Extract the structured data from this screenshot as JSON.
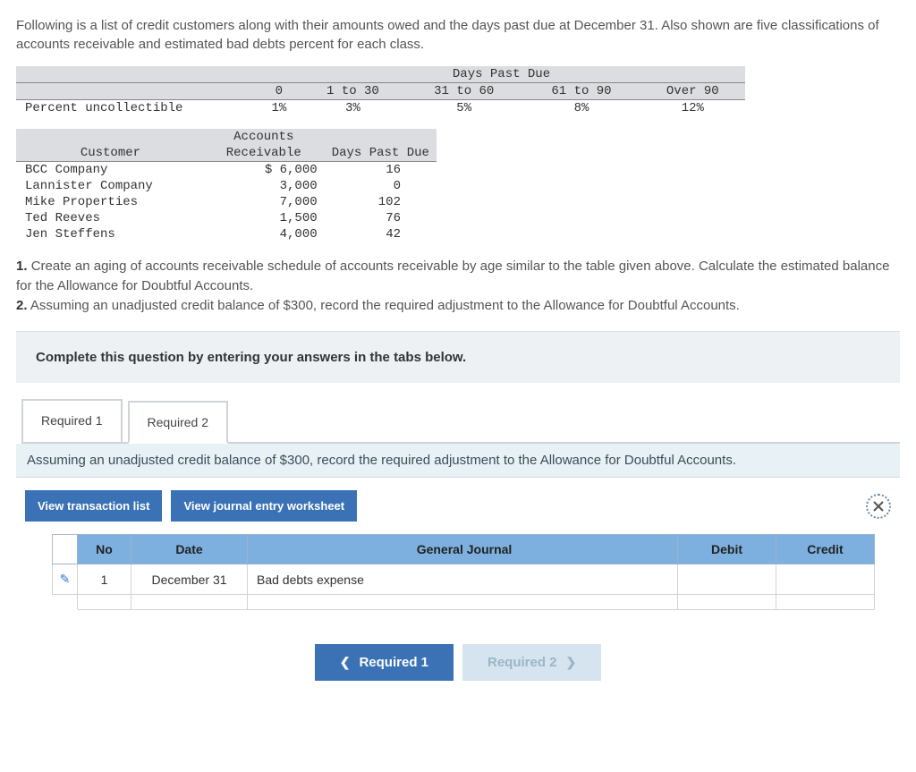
{
  "intro": "Following is a list of credit customers along with their amounts owed and the days past due at December 31. Also shown are five classifications of accounts receivable and estimated bad debts percent for each class.",
  "aging": {
    "top_header": "Days Past Due",
    "cols": [
      "0",
      "1 to 30",
      "31 to 60",
      "61 to 90",
      "Over 90"
    ],
    "row_label": "Percent uncollectible",
    "percents": [
      "1%",
      "3%",
      "5%",
      "8%",
      "12%"
    ]
  },
  "customers": {
    "headers": [
      "Customer",
      "Accounts Receivable",
      "Days Past Due"
    ],
    "rows": [
      {
        "name": "BCC Company",
        "ar": "$ 6,000",
        "dpd": "16"
      },
      {
        "name": "Lannister Company",
        "ar": "3,000",
        "dpd": "0"
      },
      {
        "name": "Mike Properties",
        "ar": "7,000",
        "dpd": "102"
      },
      {
        "name": "Ted Reeves",
        "ar": "1,500",
        "dpd": "76"
      },
      {
        "name": "Jen Steffens",
        "ar": "4,000",
        "dpd": "42"
      }
    ]
  },
  "questions": {
    "q1": "Create an aging of accounts receivable schedule of accounts receivable by age similar to the table given above. Calculate the estimated balance for the Allowance for Doubtful Accounts.",
    "q2": "Assuming an unadjusted credit balance of $300, record the required adjustment to the Allowance for Doubtful Accounts."
  },
  "complete": "Complete this question by entering your answers in the tabs below.",
  "tabs": {
    "t1": "Required 1",
    "t2": "Required 2"
  },
  "prompt": "Assuming an unadjusted credit balance of $300, record the required adjustment to the Allowance for Doubtful Accounts.",
  "buttons": {
    "vtl": "View transaction list",
    "vjew": "View journal entry worksheet"
  },
  "journal": {
    "headers": {
      "no": "No",
      "date": "Date",
      "gj": "General Journal",
      "debit": "Debit",
      "credit": "Credit"
    },
    "rows": [
      {
        "no": "1",
        "date": "December 31",
        "gj": "Bad debts expense",
        "debit": "",
        "credit": ""
      },
      {
        "no": "",
        "date": "",
        "gj": "",
        "debit": "",
        "credit": ""
      }
    ]
  },
  "nav": {
    "prev": "Required 1",
    "next": "Required 2"
  },
  "chart_data": {
    "type": "table",
    "aging_schedule": {
      "buckets": [
        "0",
        "1 to 30",
        "31 to 60",
        "61 to 90",
        "Over 90"
      ],
      "percent_uncollectible": [
        1,
        3,
        5,
        8,
        12
      ]
    },
    "customers": [
      {
        "customer": "BCC Company",
        "accounts_receivable": 6000,
        "days_past_due": 16
      },
      {
        "customer": "Lannister Company",
        "accounts_receivable": 3000,
        "days_past_due": 0
      },
      {
        "customer": "Mike Properties",
        "accounts_receivable": 7000,
        "days_past_due": 102
      },
      {
        "customer": "Ted Reeves",
        "accounts_receivable": 1500,
        "days_past_due": 76
      },
      {
        "customer": "Jen Steffens",
        "accounts_receivable": 4000,
        "days_past_due": 42
      }
    ],
    "unadjusted_credit_balance": 300
  }
}
